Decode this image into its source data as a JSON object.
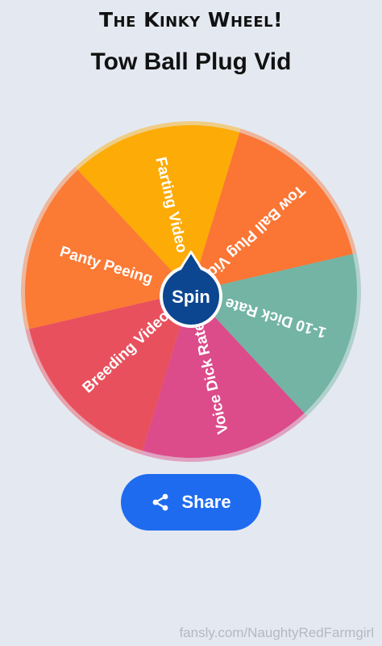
{
  "header": {
    "title": "The Kinky Wheel!",
    "result": "Tow Ball Plug Vid"
  },
  "wheel": {
    "segments": [
      {
        "label": "Tow Ball Plug Vid",
        "color": "#fb7535"
      },
      {
        "label": "1-10 Dick Rate",
        "color": "#73b4a4"
      },
      {
        "label": "Voice Dick Rate",
        "color": "#dc4b8a"
      },
      {
        "label": "Breeding Video",
        "color": "#e9505d"
      },
      {
        "label": "Panty Peeing",
        "color": "#fb7a34"
      },
      {
        "label": "Farting Video",
        "color": "#fdab06"
      }
    ],
    "spin_label": "Spin",
    "hub_color": "#0d4690"
  },
  "share": {
    "label": "Share",
    "icon": "share-icon",
    "color": "#1f6bef"
  },
  "watermark": "fansly.com/NaughtyRedFarmgirl"
}
